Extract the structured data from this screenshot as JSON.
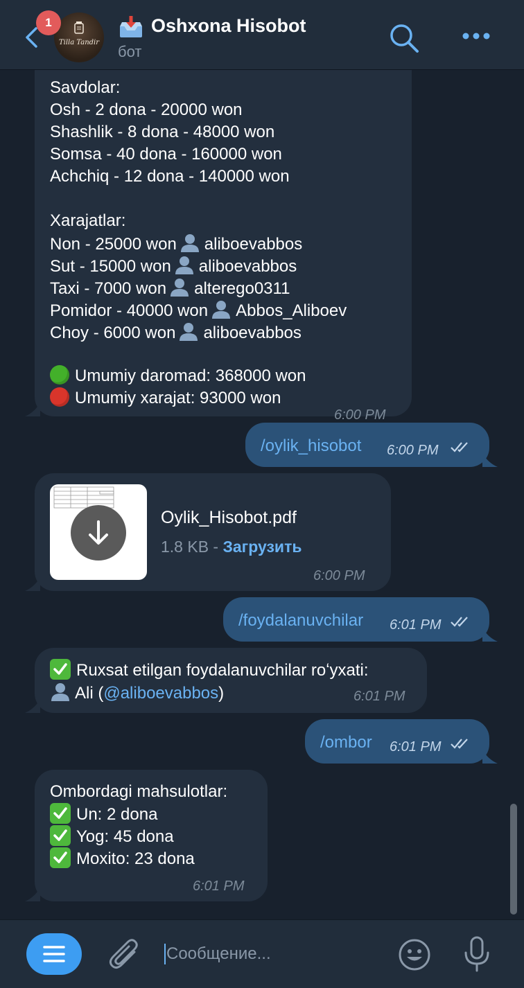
{
  "header": {
    "unread_badge": "1",
    "avatar_text": "Tilla Tandir",
    "title": "Oshxona Hisobot",
    "subtitle": "бот"
  },
  "messages": {
    "report": {
      "lines": [
        "Savdolar:",
        "Osh - 2 dona - 20000 won",
        "Shashlik - 8 dona - 48000 won",
        "Somsa - 40 dona - 160000 won",
        "Achchiq - 12 dona - 140000 won",
        "",
        "Xarajatlar:"
      ],
      "expenses": [
        {
          "item": "Non - 25000 won",
          "user": "aliboevabbos"
        },
        {
          "item": "Sut - 15000 won",
          "user": "aliboevabbos"
        },
        {
          "item": "Taxi - 7000 won",
          "user": "alterego0311"
        },
        {
          "item": "Pomidor - 40000 won",
          "user": "Abbos_Aliboev"
        },
        {
          "item": "Choy - 6000 won",
          "user": "aliboevabbos"
        }
      ],
      "income": "Umumiy daromad: 368000 won",
      "expense_total": "Umumiy xarajat: 93000 won",
      "time": "6:00 PM"
    },
    "cmd_oylik": {
      "text": "/oylik_hisobot",
      "time": "6:00 PM"
    },
    "file": {
      "name": "Oylik_Hisobot.pdf",
      "size": "1.8 KB - ",
      "download": "Загрузить",
      "time": "6:00 PM"
    },
    "cmd_foydalanuvchilar": {
      "text": "/foydalanuvchilar",
      "time": "6:01 PM"
    },
    "users": {
      "heading": "Ruxsat etilgan foydalanuvchilar roʻyxati:",
      "name_prefix": "Ali (",
      "mention": "@aliboevabbos",
      "name_suffix": ")",
      "time": "6:01 PM"
    },
    "cmd_ombor": {
      "text": "/ombor",
      "time": "6:01 PM"
    },
    "ombor": {
      "heading": "Ombordagi mahsulotlar:",
      "items": [
        "Un: 2 dona",
        "Yog: 45 dona",
        "Moxito: 23 dona"
      ],
      "time": "6:01 PM"
    }
  },
  "composer": {
    "placeholder": "Сообщение..."
  },
  "colors": {
    "background": "#18212d",
    "header": "#212d3b",
    "incoming_bubble": "#232f3e",
    "outgoing_bubble": "#2b5278",
    "accent": "#6ab2f2",
    "badge": "#e25b5b"
  },
  "icons": [
    "back-icon",
    "search-icon",
    "more-icon",
    "inbox-tray-icon",
    "download-icon",
    "double-check-icon",
    "user-icon",
    "attach-icon",
    "emoji-icon",
    "microphone-icon",
    "menu-icon"
  ]
}
